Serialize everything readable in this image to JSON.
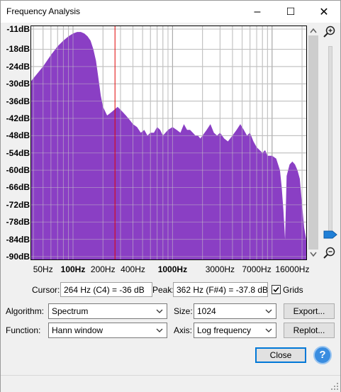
{
  "window": {
    "title": "Frequency Analysis",
    "minimize": "–",
    "maximize": "☐",
    "close": "✕"
  },
  "plot": {
    "fill_color": "#8a3fc4",
    "y_labels": [
      "-11dB",
      "-18dB",
      "-24dB",
      "-30dB",
      "-36dB",
      "-42dB",
      "-48dB",
      "-54dB",
      "-60dB",
      "-66dB",
      "-72dB",
      "-78dB",
      "-84dB",
      "-90dB"
    ],
    "x_labels": [
      {
        "text": "50Hz",
        "bold": false
      },
      {
        "text": "100Hz",
        "bold": true
      },
      {
        "text": "200Hz",
        "bold": false
      },
      {
        "text": "400Hz",
        "bold": false
      },
      {
        "text": "1000Hz",
        "bold": true
      },
      {
        "text": "3000Hz",
        "bold": false
      },
      {
        "text": "7000Hz",
        "bold": false
      },
      {
        "text": "16000Hz",
        "bold": false
      }
    ]
  },
  "chart_data": {
    "type": "area",
    "x_scale": "log",
    "x_unit": "Hz",
    "y_unit": "dB",
    "ylim": [
      -91,
      -10
    ],
    "xlim": [
      38,
      22050
    ],
    "grid": true,
    "x": [
      38,
      50,
      60,
      70,
      80,
      90,
      100,
      110,
      120,
      130,
      140,
      150,
      160,
      170,
      180,
      190,
      200,
      220,
      240,
      260,
      280,
      300,
      320,
      340,
      360,
      380,
      400,
      440,
      480,
      520,
      560,
      600,
      650,
      700,
      750,
      800,
      900,
      1000,
      1100,
      1200,
      1300,
      1400,
      1500,
      1600,
      1700,
      1800,
      1900,
      2000,
      2200,
      2400,
      2600,
      2800,
      3000,
      3300,
      3600,
      4000,
      4400,
      4800,
      5200,
      5600,
      6000,
      6500,
      7000,
      7500,
      8000,
      8500,
      9000,
      10000,
      11000,
      12000,
      12500,
      13000,
      13500,
      14000,
      15000,
      16000,
      17000,
      18000,
      19000,
      20000,
      21000,
      22050
    ],
    "y": [
      -29,
      -24,
      -20,
      -17,
      -15,
      -13.5,
      -12.5,
      -12,
      -12,
      -12.5,
      -13.5,
      -15,
      -18,
      -22,
      -28,
      -34,
      -38,
      -41,
      -40,
      -39,
      -38,
      -39,
      -40,
      -41,
      -42,
      -43,
      -44,
      -45,
      -47,
      -46,
      -48,
      -47,
      -47,
      -45,
      -46,
      -48,
      -46,
      -45,
      -46,
      -47,
      -44,
      -46,
      -46,
      -47,
      -48,
      -48,
      -49,
      -48,
      -46,
      -44,
      -47,
      -48,
      -47,
      -49,
      -50,
      -48,
      -46,
      -44,
      -46,
      -48,
      -47,
      -50,
      -52,
      -53,
      -54,
      -53,
      -55,
      -55,
      -56,
      -60,
      -66,
      -74,
      -84,
      -62,
      -58,
      -57,
      -58,
      -60,
      -63,
      -72,
      -80,
      -84
    ],
    "annotations": [
      {
        "type": "cursor_line",
        "x": 264
      }
    ]
  },
  "cursor": {
    "label": "Cursor:",
    "value": "264 Hz (C4) = -36 dB"
  },
  "peak": {
    "label": "Peak:",
    "value": "362 Hz (F#4) = -37.8 dB"
  },
  "grids": {
    "label": "Grids",
    "checked": true
  },
  "algorithm": {
    "label": "Algorithm:",
    "value": "Spectrum"
  },
  "size": {
    "label": "Size:",
    "value": "1024"
  },
  "function": {
    "label": "Function:",
    "value": "Hann window"
  },
  "axis": {
    "label": "Axis:",
    "value": "Log frequency"
  },
  "buttons": {
    "export": "Export...",
    "replot": "Replot...",
    "close": "Close",
    "help": "?"
  }
}
